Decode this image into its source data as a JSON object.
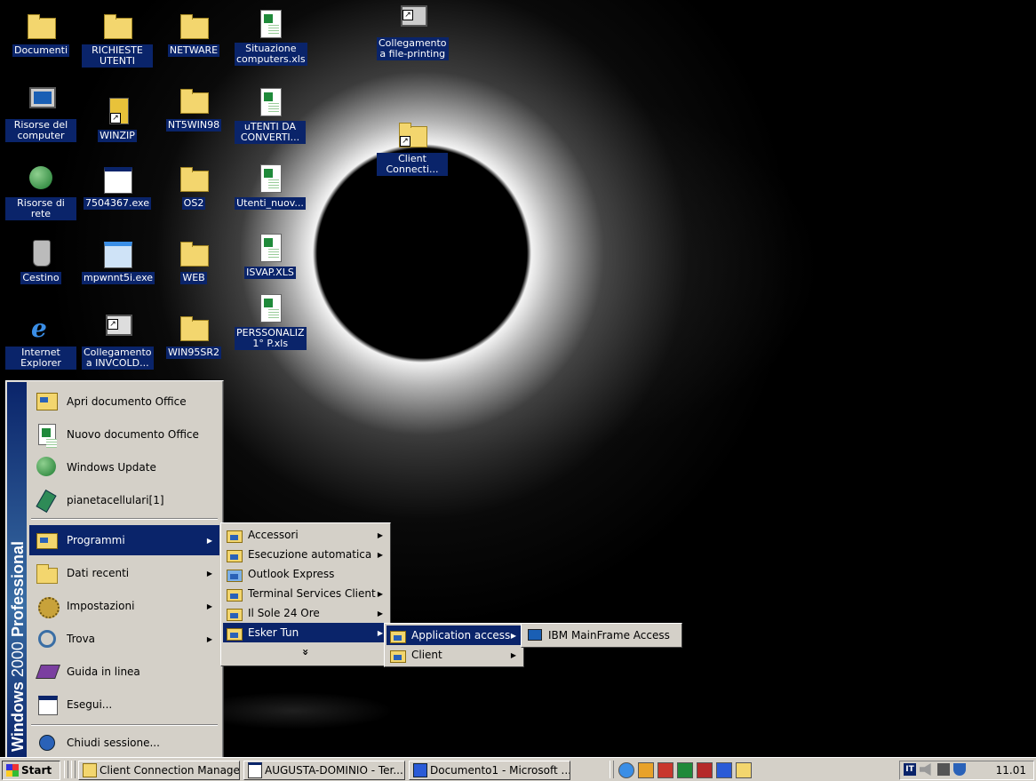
{
  "desktop_icons": {
    "documenti": "Documenti",
    "richieste": "RICHIESTE UTENTI",
    "netware": "NETWARE",
    "situazione": "Situazione computers.xls",
    "collegamento_fp": "Collegamento a file-printing",
    "risorse_computer": "Risorse del computer",
    "winzip": "WINZIP",
    "nt5win98": "NT5WIN98",
    "utenti_conv": "uTENTI DA CONVERTI...",
    "client_conn": "Client Connecti...",
    "risorse_rete": "Risorse di rete",
    "exe7504": "7504367.exe",
    "os2": "OS2",
    "utenti_nuov": "Utenti_nuov...",
    "cestino": "Cestino",
    "mpwnnt": "mpwnnt5i.exe",
    "web": "WEB",
    "isvap": "ISVAP.XLS",
    "ie": "Internet Explorer",
    "coll_invcold": "Collegamento a INVCOLD...",
    "win95sr2": "WIN95SR2",
    "perss": "PERSSONALIZ 1° P.xls"
  },
  "start_menu": {
    "banner_brand": "Windows",
    "banner_version": "2000",
    "banner_edition": "Professional",
    "items": {
      "apri": "Apri documento Office",
      "nuovo": "Nuovo documento Office",
      "update": "Windows Update",
      "pianeta": "pianetacellulari[1]",
      "programmi": "Programmi",
      "dati": "Dati recenti",
      "impostazioni": "Impostazioni",
      "trova": "Trova",
      "guida": "Guida in linea",
      "esegui": "Esegui...",
      "chiudi": "Chiudi sessione..."
    }
  },
  "programs_menu": {
    "accessori": "Accessori",
    "esecuzione": "Esecuzione automatica",
    "outlook": "Outlook Express",
    "terminal": "Terminal Services Client",
    "sole": "Il Sole 24 Ore",
    "esker": "Esker Tun",
    "more": "»"
  },
  "esker_menu": {
    "app_access": "Application access",
    "client": "Client"
  },
  "app_access_menu": {
    "ibm": "IBM MainFrame Access"
  },
  "taskbar": {
    "start": "Start",
    "tasks": {
      "ccm": "Client Connection Manager",
      "augusta": "AUGUSTA-DOMINIO - Ter...",
      "doc1": "Documento1 - Microsoft ..."
    },
    "tray_lang": "IT",
    "clock": "11.01"
  }
}
